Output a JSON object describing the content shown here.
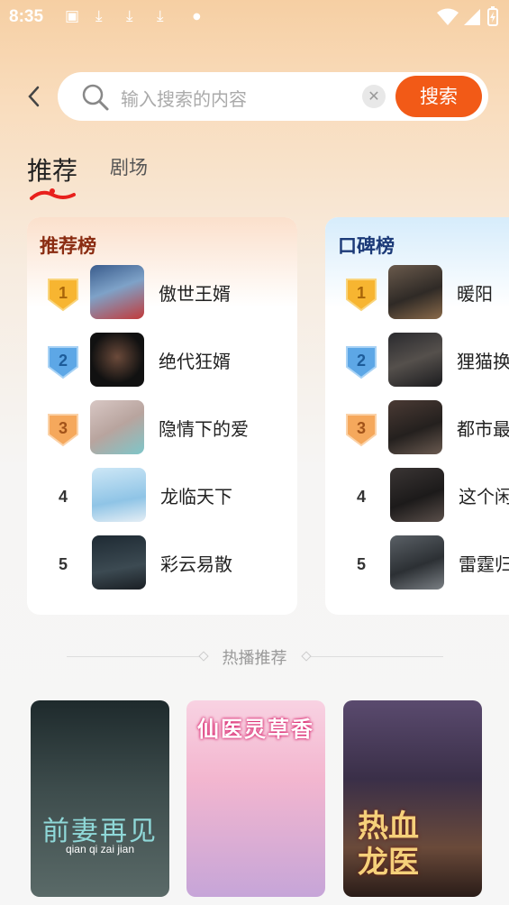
{
  "status_bar": {
    "time": "8:35"
  },
  "search": {
    "placeholder": "输入搜索的内容",
    "button": "搜索"
  },
  "tabs": [
    {
      "label": "推荐"
    },
    {
      "label": "剧场"
    }
  ],
  "rank_cards": [
    {
      "title": "推荐榜",
      "items": [
        {
          "rank": "1",
          "name": "傲世王婿"
        },
        {
          "rank": "2",
          "name": "绝代狂婿"
        },
        {
          "rank": "3",
          "name": "隐情下的爱"
        },
        {
          "rank": "4",
          "name": "龙临天下"
        },
        {
          "rank": "5",
          "name": "彩云易散"
        }
      ]
    },
    {
      "title": "口碑榜",
      "items": [
        {
          "rank": "1",
          "name": "暖阳"
        },
        {
          "rank": "2",
          "name": "狸猫换"
        },
        {
          "rank": "3",
          "name": "都市最"
        },
        {
          "rank": "4",
          "name": "这个闲"
        },
        {
          "rank": "5",
          "name": "雷霆归"
        }
      ]
    }
  ],
  "hot": {
    "title": "热播推荐",
    "posters": [
      {
        "title": "前妻再见",
        "subtitle": "qian qi zai jian"
      },
      {
        "title": "仙医灵草香"
      },
      {
        "title": "热血龙医"
      }
    ]
  }
}
